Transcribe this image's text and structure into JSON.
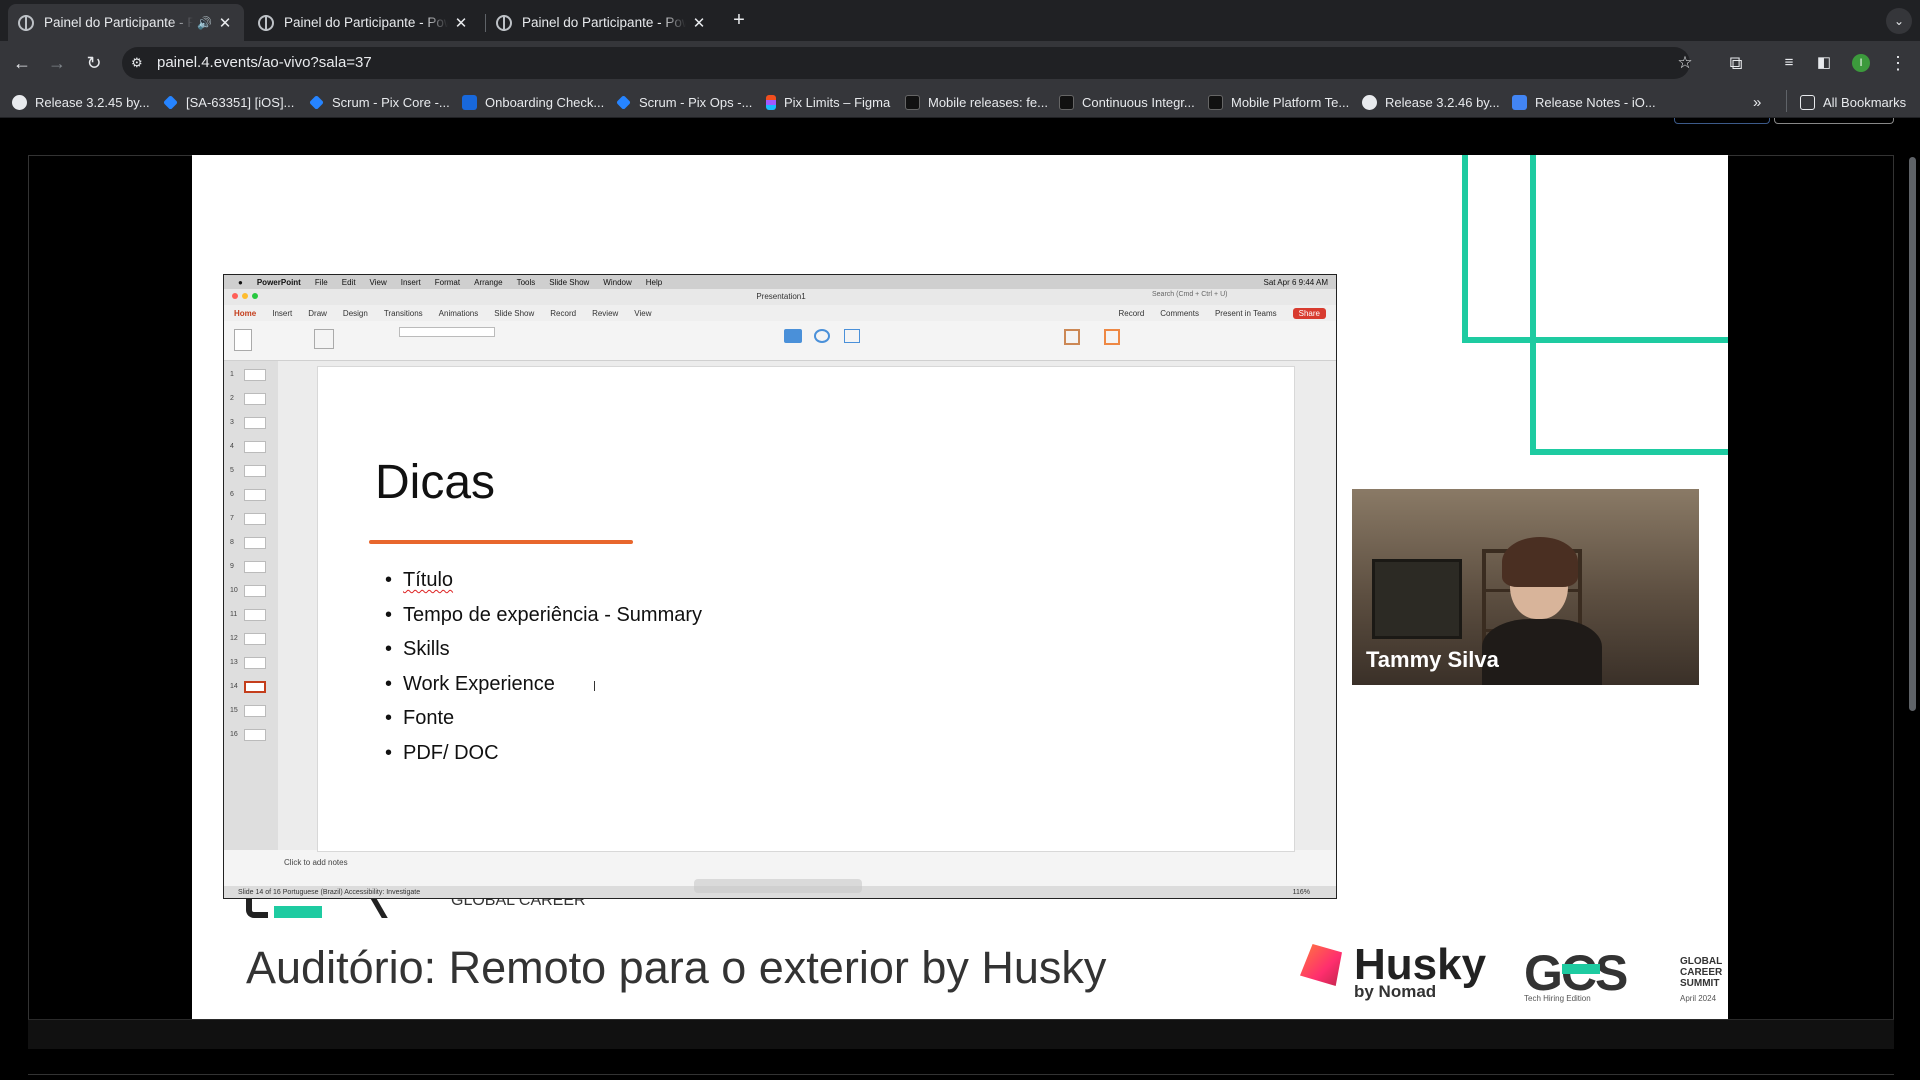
{
  "browser": {
    "tabs": [
      {
        "title": "Painel do Participante - P",
        "active": true,
        "audio": true
      },
      {
        "title": "Painel do Participante - Powe",
        "active": false
      },
      {
        "title": "Painel do Participante - Powe",
        "active": false
      }
    ],
    "url": "painel.4.events/ao-vivo?sala=37",
    "bookmarks": [
      {
        "label": "Release 3.2.45 by...",
        "icon": "github-icon"
      },
      {
        "label": "[SA-63351] [iOS]...",
        "icon": "jira-icon"
      },
      {
        "label": "Scrum - Pix Core -...",
        "icon": "jira-icon"
      },
      {
        "label": "Onboarding Check...",
        "icon": "confluence-icon"
      },
      {
        "label": "Scrum - Pix Ops -...",
        "icon": "jira-icon"
      },
      {
        "label": "Pix Limits – Figma",
        "icon": "figma-icon"
      },
      {
        "label": "Mobile releases: fe...",
        "icon": "crypto-icon"
      },
      {
        "label": "Continuous Integr...",
        "icon": "crypto-icon"
      },
      {
        "label": "Mobile Platform Te...",
        "icon": "crypto-icon"
      },
      {
        "label": "Release 3.2.46 by...",
        "icon": "github-icon"
      },
      {
        "label": "Release Notes - iO...",
        "icon": "docs-icon"
      }
    ],
    "all_bookmarks": "All Bookmarks",
    "more_bookmarks": "»",
    "profile_initial": "I"
  },
  "powerpoint": {
    "app_name": "PowerPoint",
    "menu": [
      "File",
      "Edit",
      "View",
      "Insert",
      "Format",
      "Arrange",
      "Tools",
      "Slide Show",
      "Window",
      "Help"
    ],
    "clock": "Sat Apr 6  9:44 AM",
    "doc_title": "Presentation1",
    "ribbon_tabs": [
      "Home",
      "Insert",
      "Draw",
      "Design",
      "Transitions",
      "Animations",
      "Slide Show",
      "Record",
      "Review",
      "View"
    ],
    "right_actions": [
      "Record",
      "Comments",
      "Present in Teams",
      "Share"
    ],
    "search_placeholder": "Search (Cmd + Ctrl + U)",
    "thumb_numbers": [
      "1",
      "2",
      "3",
      "4",
      "5",
      "6",
      "7",
      "8",
      "9",
      "10",
      "11",
      "12",
      "13",
      "14",
      "15",
      "16"
    ],
    "notes_placeholder": "Click to add notes",
    "status": "Slide 14 of 16   Portuguese (Brazil)   Accessibility: Investigate",
    "zoom": "116%",
    "slide": {
      "title": "Dicas",
      "bullets": [
        "Título",
        "Tempo de experiência - Summary",
        "Skills",
        "Work Experience",
        "Fonte",
        "PDF/ DOC"
      ]
    }
  },
  "webcam": {
    "speaker_name": "Tammy Silva"
  },
  "banner": {
    "auditorium": "Auditório: Remoto para o exterior by Husky",
    "husky_brand": "Husky",
    "husky_sub": "by Nomad",
    "gcs_logo": "GCS",
    "gcs_text": "GLOBAL CAREER SUMMIT",
    "gcs_edition": "Tech Hiring Edition",
    "gcs_year": "April 2024",
    "old_logo_text": "GLOBAL CAREER"
  },
  "colors": {
    "accent_green": "#1ecba1",
    "husky_pink": "#ff3d6e",
    "underline_orange": "#e8672d"
  }
}
